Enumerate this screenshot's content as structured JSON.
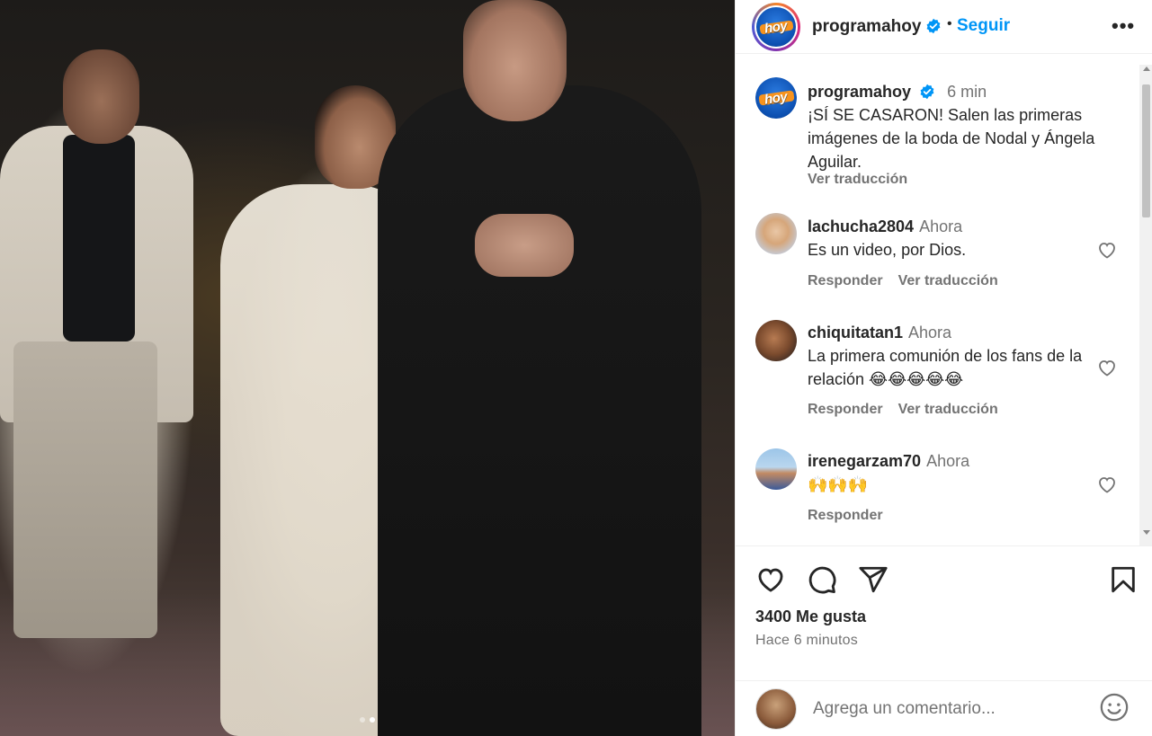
{
  "post": {
    "account": "programahoy",
    "follow_label": "Seguir",
    "more_label": "•••",
    "logo_text": "hoy",
    "caption_time": "6 min",
    "caption": "¡SÍ SE CASARON! Salen las primeras imágenes de la boda de Nodal y Ángela Aguilar.",
    "translate_label": "Ver traducción",
    "media_alt": "Wedding photo: bride in white lace dress walking arm in arm with a man in a black suit",
    "carousel": {
      "total": 2,
      "active": 2
    }
  },
  "comments": [
    {
      "user": "lachucha2804",
      "time": "Ahora",
      "text": "Es un video, por Dios.",
      "reply": "Responder",
      "translate": "Ver traducción"
    },
    {
      "user": "chiquitatan1",
      "time": "Ahora",
      "text": "La primera comunión de los fans de la relación 😂😂😂😂😂",
      "reply": "Responder",
      "translate": "Ver traducción"
    },
    {
      "user": "irenegarzam70",
      "time": "Ahora",
      "text": "🙌🙌🙌",
      "reply": "Responder"
    }
  ],
  "stats": {
    "likes": "3400 Me gusta",
    "posted_ago": "Hace 6 minutos"
  },
  "composer": {
    "placeholder": "Agrega un comentario..."
  },
  "colors": {
    "accent": "#0095f6",
    "text": "#262626",
    "secondary": "#737373",
    "verified": "#0095f6"
  }
}
